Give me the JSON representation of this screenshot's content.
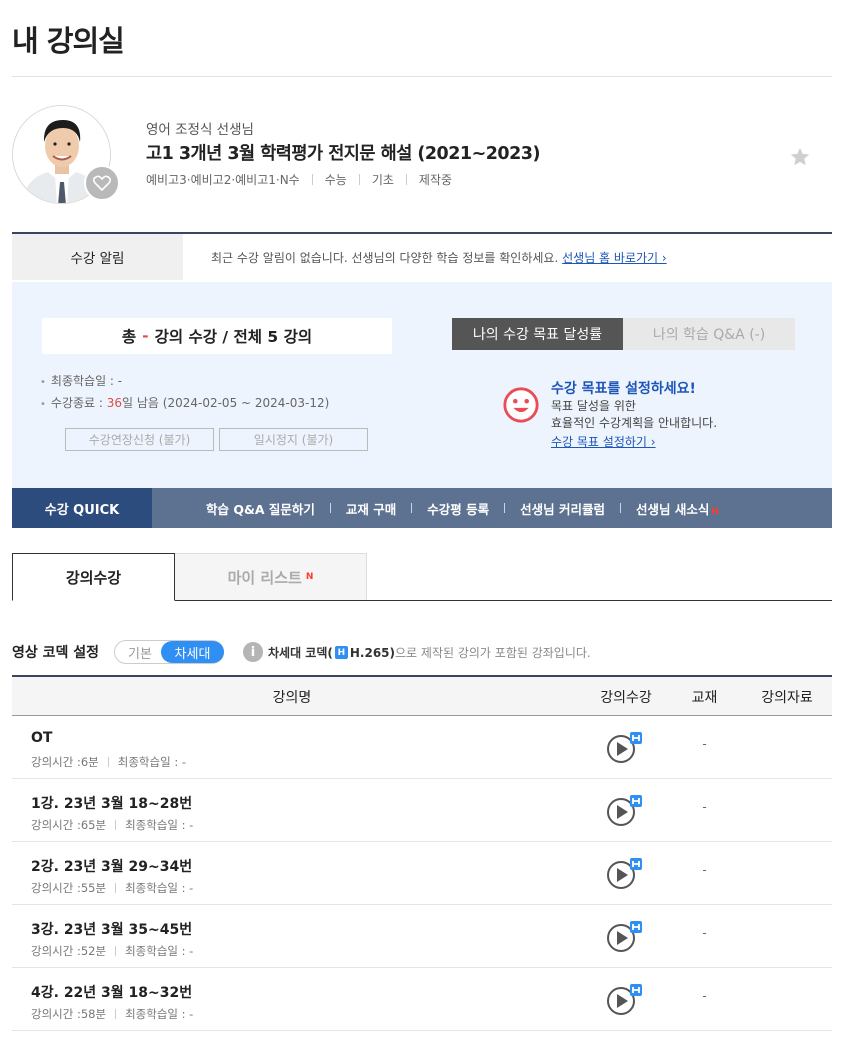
{
  "page": {
    "title": "내 강의실"
  },
  "course": {
    "subject_teacher": "영어 조정식 선생님",
    "title": "고1 3개년 3월 학력평가 전지문 해설 (2021~2023)",
    "meta": [
      "예비고3·예비고2·예비고1·N수",
      "수능",
      "기초",
      "제작중"
    ]
  },
  "notice": {
    "label": "수강 알림",
    "text": "최근 수강 알림이 없습니다. 선생님의 다양한 학습 정보를 확인하세요.",
    "link": "선생님 홈 바로가기"
  },
  "progress": {
    "total_prefix": "총",
    "total_dash": "-",
    "total_suffix": "강의 수강 / 전체 5 강의",
    "last_study_label": "최종학습일 : -",
    "end_label_prefix": "수강종료 : ",
    "end_days": "36",
    "end_label_suffix": "일 남음 (2024-02-05 ~ 2024-03-12)",
    "extend_button": "수강연장신청 (불가)",
    "pause_button": "일시정지 (불가)"
  },
  "goal": {
    "tab_active": "나의 수강 목표 달성률",
    "tab_inactive": "나의 학습 Q&A (-)",
    "title": "수강 목표를 설정하세요!",
    "desc1": "목표 달성을 위한",
    "desc2": "효율적인 수강계획을 안내합니다.",
    "link": "수강 목표 설정하기"
  },
  "quick": {
    "label": "수강 QUICK",
    "links": [
      "학습 Q&A 질문하기",
      "교재 구매",
      "수강평 등록",
      "선생님 커리큘럼",
      "선생님 새소식"
    ],
    "new_badge": "N"
  },
  "tabs": {
    "active": "강의수강",
    "inactive": "마이 리스트",
    "new_badge": "N"
  },
  "codec": {
    "label": "영상 코덱 설정",
    "option_basic": "기본",
    "option_next": "차세대",
    "info_mark": "i",
    "note_bold": "차세대 코덱(",
    "note_badge": "H",
    "note_bold2": "H.265)",
    "note_rest": "으로 제작된 강의가 포함된 강좌입니다."
  },
  "table": {
    "headers": [
      "강의명",
      "강의수강",
      "교재",
      "강의자료"
    ],
    "time_label": "강의시간 : ",
    "last_label": "최종학습일 : -",
    "rows": [
      {
        "title": "OT",
        "time": "6분",
        "book": "-"
      },
      {
        "title": "1강. 23년 3월 18~28번",
        "time": "65분",
        "book": "-"
      },
      {
        "title": "2강. 23년 3월 29~34번",
        "time": "55분",
        "book": "-"
      },
      {
        "title": "3강. 23년 3월 35~45번",
        "time": "52분",
        "book": "-"
      },
      {
        "title": "4강. 22년 3월 18~32번",
        "time": "58분",
        "book": "-"
      }
    ]
  },
  "colors": {
    "navy": "#2d4c7e",
    "quick_bar": "#5d7291",
    "accent_blue": "#2f8ff2",
    "link_blue": "#1e56b8",
    "red": "#e24b4b",
    "progress_bg": "#eef4fd"
  }
}
